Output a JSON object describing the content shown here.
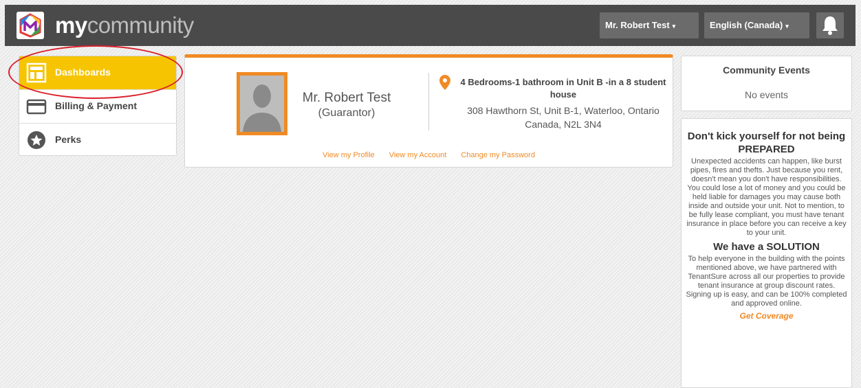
{
  "header": {
    "logo_bold": "my",
    "logo_light": "community",
    "user_menu": "Mr. Robert Test",
    "language_menu": "English (Canada)"
  },
  "sidebar": {
    "items": [
      {
        "label": "Dashboards",
        "icon": "dashboard-icon",
        "active": true
      },
      {
        "label": "Billing & Payment",
        "icon": "credit-card-icon",
        "active": false
      },
      {
        "label": "Perks",
        "icon": "star-icon",
        "active": false
      }
    ]
  },
  "profile": {
    "name": "Mr. Robert Test",
    "role": "(Guarantor)",
    "unit": "4 Bedrooms-1 bathroom in Unit B -in a 8 student house",
    "address": "308 Hawthorn St, Unit B-1, Waterloo, Ontario Canada, N2L 3N4",
    "links": [
      "View my Profile",
      "View my Account",
      "Change my Password"
    ]
  },
  "events": {
    "title": "Community Events",
    "empty": "No events"
  },
  "ad": {
    "heading1": "Don't kick yourself for not being PREPARED",
    "body1": "Unexpected accidents can happen, like burst pipes, fires and thefts. Just because you rent, doesn't mean you don't have responsibilities. You could lose a lot of money and you could be held liable for damages you may cause both inside and outside your unit. Not to mention, to be fully lease compliant, you must have tenant insurance in place before you can receive a key to your unit.",
    "heading2": "We have a SOLUTION",
    "body2": "To help everyone in the building with the points mentioned above, we have partnered with TenantSure across all our properties to provide tenant insurance at group discount rates. Signing up is easy, and can be 100% completed and approved online.",
    "cta": "Get Coverage"
  },
  "colors": {
    "accent_orange": "#f08a24",
    "active_yellow": "#f6c400",
    "topbar": "#4a4a4a",
    "highlight_red": "#d9202a"
  }
}
